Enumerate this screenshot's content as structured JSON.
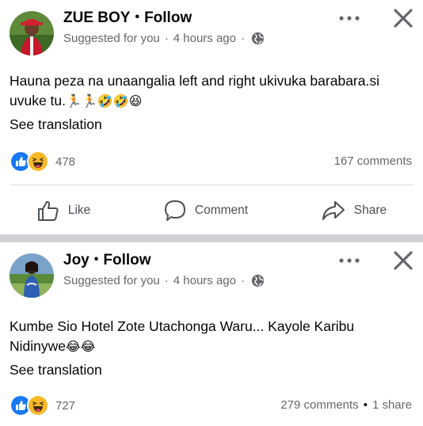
{
  "posts": [
    {
      "author": "ZUE BOY",
      "follow": "Follow",
      "suggested": "Suggested for you",
      "time": "4 hours ago",
      "text_line1": "Hauna peza na unaangalia left and right ukivuka barabara.si",
      "text_line2": "uvuke tu.",
      "text_emojis": "🏃🏃🤣🤣😆",
      "see_translation": "See translation",
      "reaction_count": "478",
      "comments": "167 comments",
      "actions": {
        "like": "Like",
        "comment": "Comment",
        "share": "Share"
      }
    },
    {
      "author": "Joy",
      "follow": "Follow",
      "suggested": "Suggested for you",
      "time": "4 hours ago",
      "text_line1": "Kumbe Sio Hotel Zote Utachonga Waru... Kayole Karibu",
      "text_line2": "Nidinywe",
      "text_emojis": "😂😂",
      "see_translation": "See translation",
      "reaction_count": "727",
      "comments": "279 comments",
      "shares": "1 share"
    }
  ],
  "icons": [
    "avatar",
    "globe-icon",
    "more-icon",
    "close-icon",
    "like-reaction-icon",
    "haha-reaction-icon",
    "thumbs-up-icon",
    "comment-icon",
    "share-icon"
  ],
  "colors": {
    "like_blue": "#1877f2",
    "haha_yellow": "#f7b928",
    "divider": "#ced0d4",
    "meta_gray": "#65676b"
  }
}
